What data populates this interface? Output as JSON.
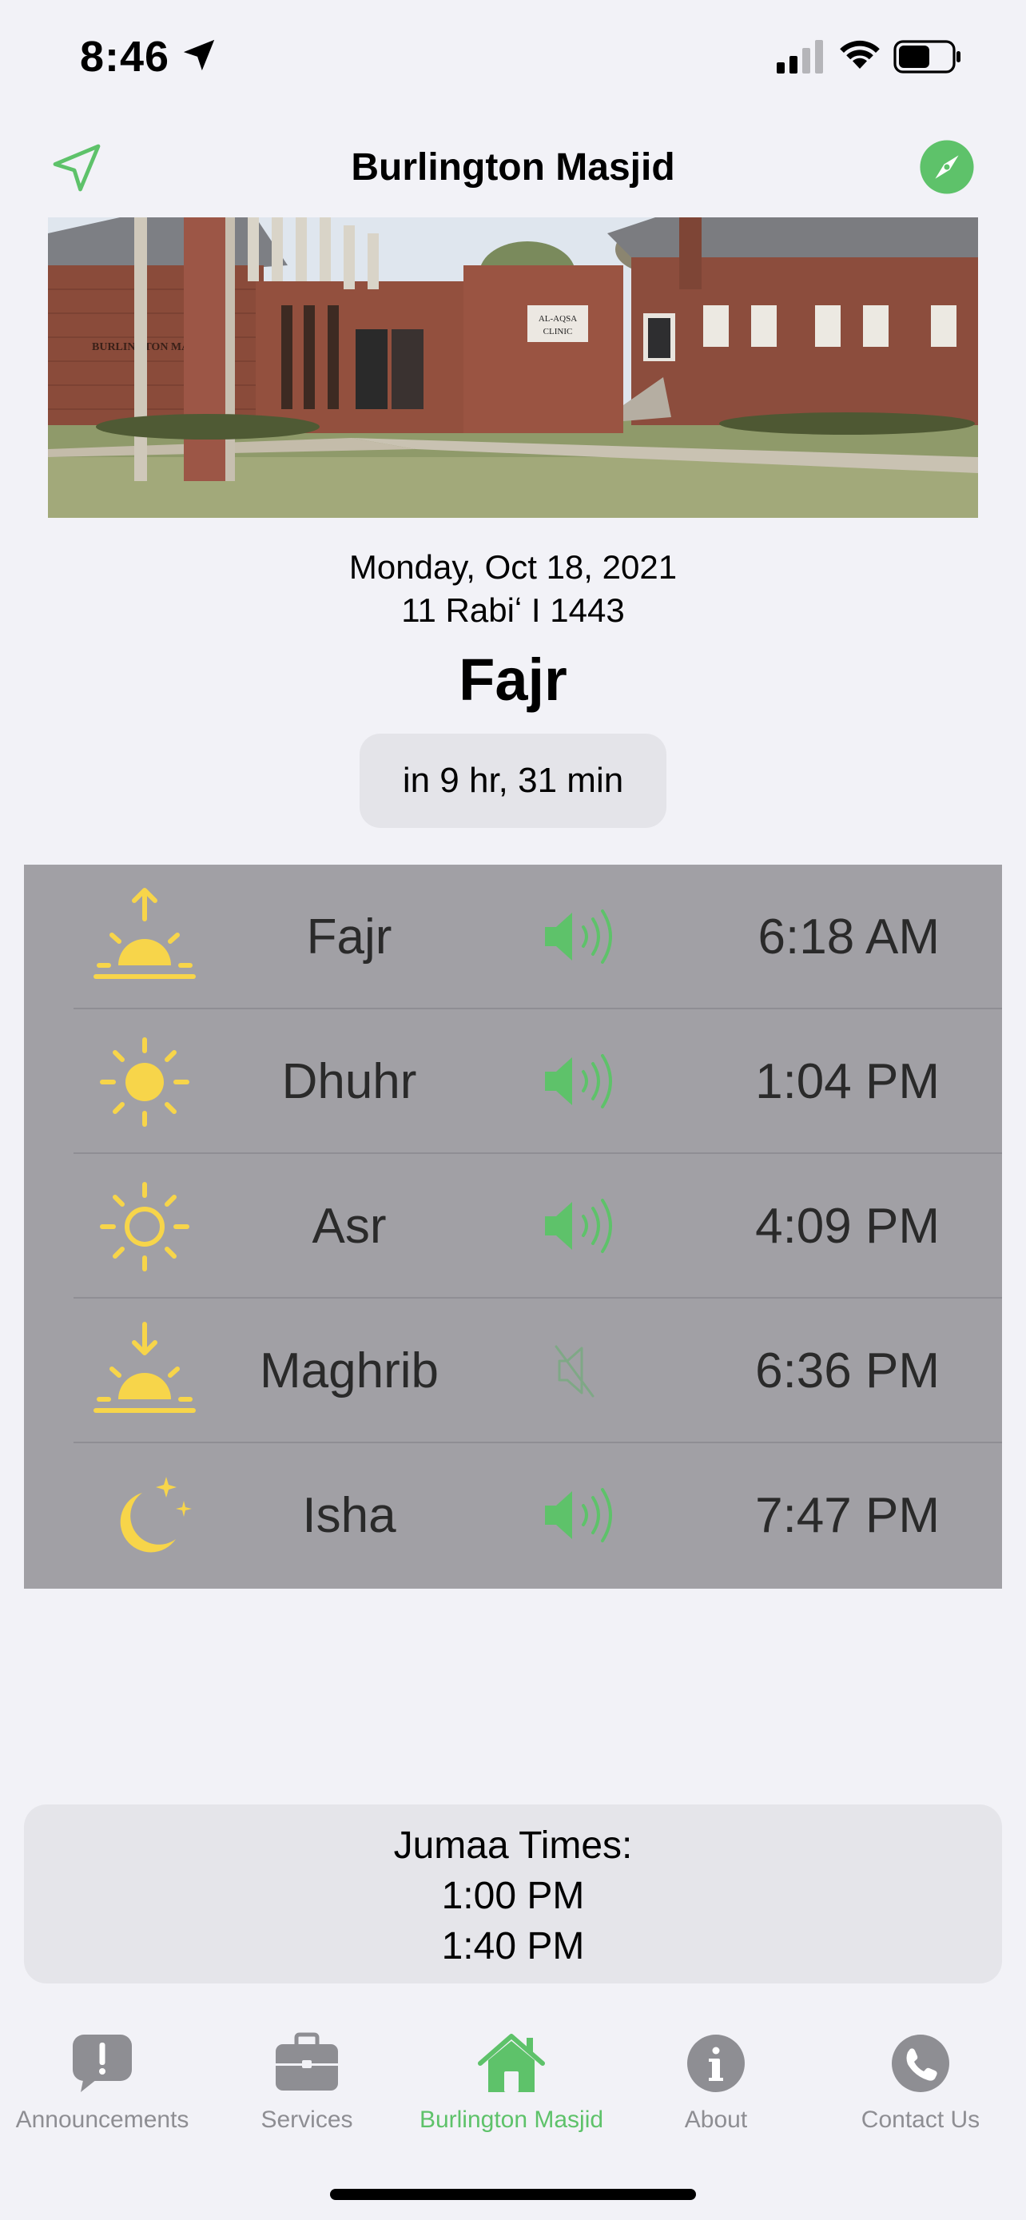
{
  "status_bar": {
    "time": "8:46"
  },
  "nav": {
    "title": "Burlington Masjid"
  },
  "hero": {
    "sign_building": "BURLINGTON MASJID",
    "sign_clinic_1": "AL-AQSA",
    "sign_clinic_2": "CLINIC"
  },
  "dates": {
    "gregorian": "Monday, Oct 18, 2021",
    "hijri": "11 Rabiʻ I 1443"
  },
  "next_prayer": {
    "name": "Fajr",
    "countdown": "in 9 hr, 31 min"
  },
  "prayers": [
    {
      "name": "Fajr",
      "time": "6:18 AM",
      "icon": "sunrise-icon",
      "sound": "on"
    },
    {
      "name": "Dhuhr",
      "time": "1:04 PM",
      "icon": "sun-icon",
      "sound": "on"
    },
    {
      "name": "Asr",
      "time": "4:09 PM",
      "icon": "sun-outline-icon",
      "sound": "on"
    },
    {
      "name": "Maghrib",
      "time": "6:36 PM",
      "icon": "sunset-icon",
      "sound": "muted"
    },
    {
      "name": "Isha",
      "time": "7:47 PM",
      "icon": "moon-stars-icon",
      "sound": "on"
    }
  ],
  "jumaa": {
    "title": "Jumaa Times:",
    "times": [
      "1:00 PM",
      "1:40 PM"
    ]
  },
  "tabs": [
    {
      "label": "Announcements",
      "icon": "exclamation-bubble-icon",
      "active": false
    },
    {
      "label": "Services",
      "icon": "briefcase-icon",
      "active": false
    },
    {
      "label": "Burlington Masjid",
      "icon": "house-icon",
      "active": true
    },
    {
      "label": "About",
      "icon": "info-icon",
      "active": false
    },
    {
      "label": "Contact Us",
      "icon": "phone-icon",
      "active": false
    }
  ],
  "colors": {
    "accent": "#5ec26a",
    "icon_yellow": "#f7d54a",
    "table_bg": "#a1a0a5",
    "tab_gray": "#8e8e93"
  }
}
